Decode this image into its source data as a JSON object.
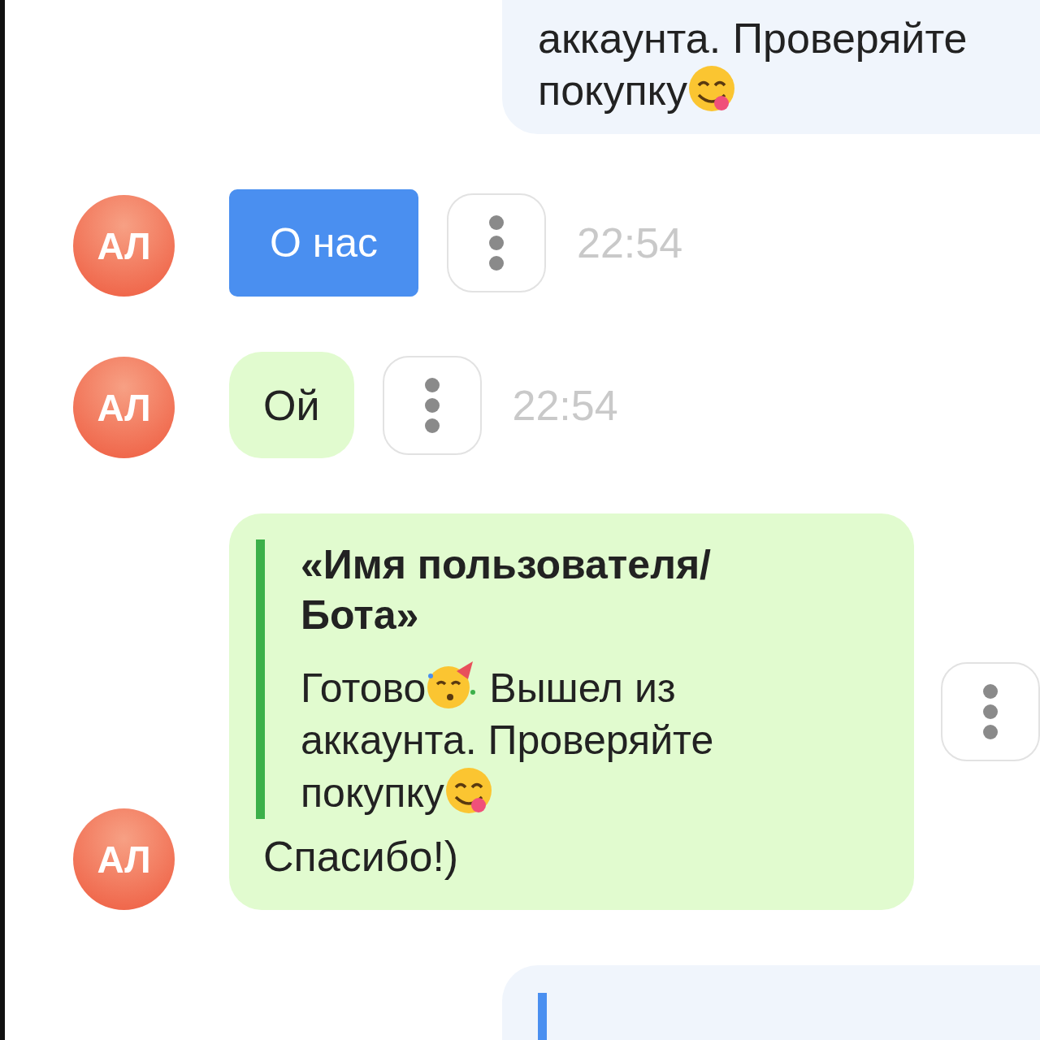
{
  "messages": [
    {
      "kind": "outgoing",
      "text": "аккаунта. Проверяйте покупку"
    },
    {
      "kind": "button",
      "avatar": "АЛ",
      "label": "О нас",
      "time": "22:54"
    },
    {
      "kind": "text",
      "avatar": "АЛ",
      "text": "Ой",
      "time": "22:54"
    },
    {
      "kind": "reply",
      "avatar": "АЛ",
      "quote_title": "«Имя пользователя/ Бота»",
      "quote_parts": [
        "Готово",
        "Вышел из аккаунта. Проверяйте покупку"
      ],
      "text": "Спасибо!)"
    },
    {
      "kind": "outgoing_quote"
    }
  ]
}
